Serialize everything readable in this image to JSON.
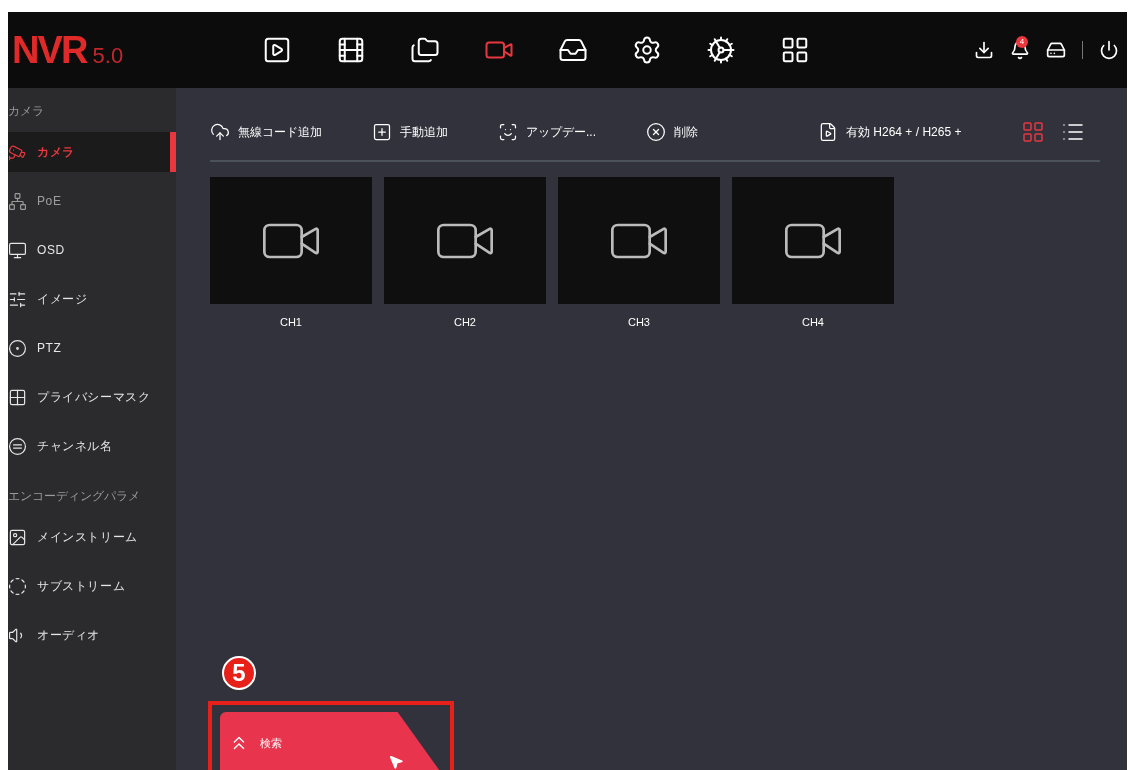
{
  "header": {
    "logo": "NVR",
    "version": "5.0",
    "nav": [
      {
        "kind": "playback",
        "selected": false
      },
      {
        "kind": "film",
        "selected": false
      },
      {
        "kind": "folder",
        "selected": false
      },
      {
        "kind": "camera",
        "selected": true
      },
      {
        "kind": "inbox",
        "selected": false
      },
      {
        "kind": "gear",
        "selected": false
      },
      {
        "kind": "gear-doc",
        "selected": false
      },
      {
        "kind": "grid",
        "selected": false
      }
    ],
    "notification_count": "4"
  },
  "sidebar": [
    {
      "heading": "カメラ",
      "items": [
        {
          "label": "カメラ",
          "kind": "camera",
          "selected": true,
          "disabled": false
        },
        {
          "label": "PoE",
          "kind": "poe",
          "selected": false,
          "disabled": true
        },
        {
          "label": "OSD",
          "kind": "monitor",
          "selected": false,
          "disabled": false
        },
        {
          "label": "イメージ",
          "kind": "sliders",
          "selected": false,
          "disabled": false
        },
        {
          "label": "PTZ",
          "kind": "ptz",
          "selected": false,
          "disabled": false
        },
        {
          "label": "プライバシーマスク",
          "kind": "mask",
          "selected": false,
          "disabled": false
        },
        {
          "label": "チャンネル名",
          "kind": "channel",
          "selected": false,
          "disabled": false
        }
      ]
    },
    {
      "heading": "エンコーディングパラメ",
      "items": [
        {
          "label": "メインストリーム",
          "kind": "stream-box",
          "selected": false,
          "disabled": false
        },
        {
          "label": "サブストリーム",
          "kind": "stream-circle",
          "selected": false,
          "disabled": false
        },
        {
          "label": "オーディオ",
          "kind": "audio",
          "selected": false,
          "disabled": false
        }
      ]
    }
  ],
  "toolbar": [
    {
      "label": "無線コード追加",
      "kind": "cloud"
    },
    {
      "label": "手動追加",
      "kind": "manual"
    },
    {
      "label": "アップデー...",
      "kind": "update"
    },
    {
      "label": "削除",
      "kind": "delete"
    },
    {
      "label": "有効 H264 + / H265 +",
      "kind": "codec"
    }
  ],
  "view_modes": [
    {
      "kind": "grid",
      "selected": true
    },
    {
      "kind": "list",
      "selected": false
    }
  ],
  "channels": [
    {
      "label": "CH1"
    },
    {
      "label": "CH2"
    },
    {
      "label": "CH3"
    },
    {
      "label": "CH4"
    }
  ],
  "annotation": {
    "number": "5"
  },
  "search_tab": {
    "label": "検索"
  }
}
